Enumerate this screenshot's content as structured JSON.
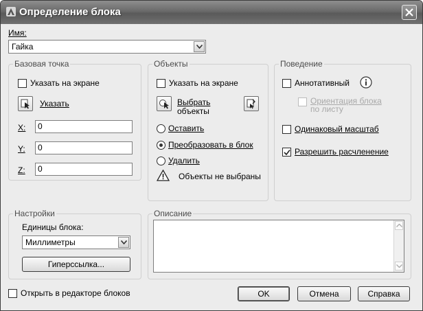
{
  "window": {
    "title": "Определение блока",
    "close_glyph": "✕"
  },
  "name": {
    "label": "Имя:",
    "value": "Гайка"
  },
  "base_point": {
    "title": "Базовая точка",
    "specify_on_screen": {
      "label": "Указать на экране",
      "checked": false
    },
    "pick_button": {
      "label": "Указать"
    },
    "x": {
      "label": "X:",
      "value": "0"
    },
    "y": {
      "label": "Y:",
      "value": "0"
    },
    "z": {
      "label": "Z:",
      "value": "0"
    }
  },
  "objects": {
    "title": "Объекты",
    "specify_on_screen": {
      "label": "Указать на экране",
      "checked": false
    },
    "select_button": {
      "label_line1": "Выбрать",
      "label_line2": "объекты"
    },
    "retain": {
      "label": "Оставить",
      "selected": false
    },
    "convert": {
      "label": "Преобразовать в блок",
      "selected": true
    },
    "delete": {
      "label": "Удалить",
      "selected": false
    },
    "status": "Объекты не выбраны"
  },
  "behavior": {
    "title": "Поведение",
    "annotative": {
      "label": "Аннотативный",
      "checked": false
    },
    "orientation": {
      "label_line1": "Ориентация блока",
      "label_line2": "по листу",
      "checked": false,
      "enabled": false
    },
    "uniform_scale": {
      "label": "Одинаковый масштаб",
      "checked": false
    },
    "allow_explode": {
      "label": "Разрешить расчленение",
      "checked": true
    }
  },
  "settings": {
    "title": "Настройки",
    "units_label": "Единицы блока:",
    "units_value": "Миллиметры",
    "hyperlink_button": "Гиперссылка..."
  },
  "description": {
    "title": "Описание",
    "value": ""
  },
  "footer": {
    "open_in_editor": {
      "label": "Открыть в редакторе блоков",
      "checked": false
    },
    "ok": "OK",
    "cancel": "Отмена",
    "help": "Справка"
  },
  "colors": {
    "titlebar": "#6a6a6a",
    "dialog_bg": "#ececec",
    "group_border": "#cfcfcf"
  }
}
